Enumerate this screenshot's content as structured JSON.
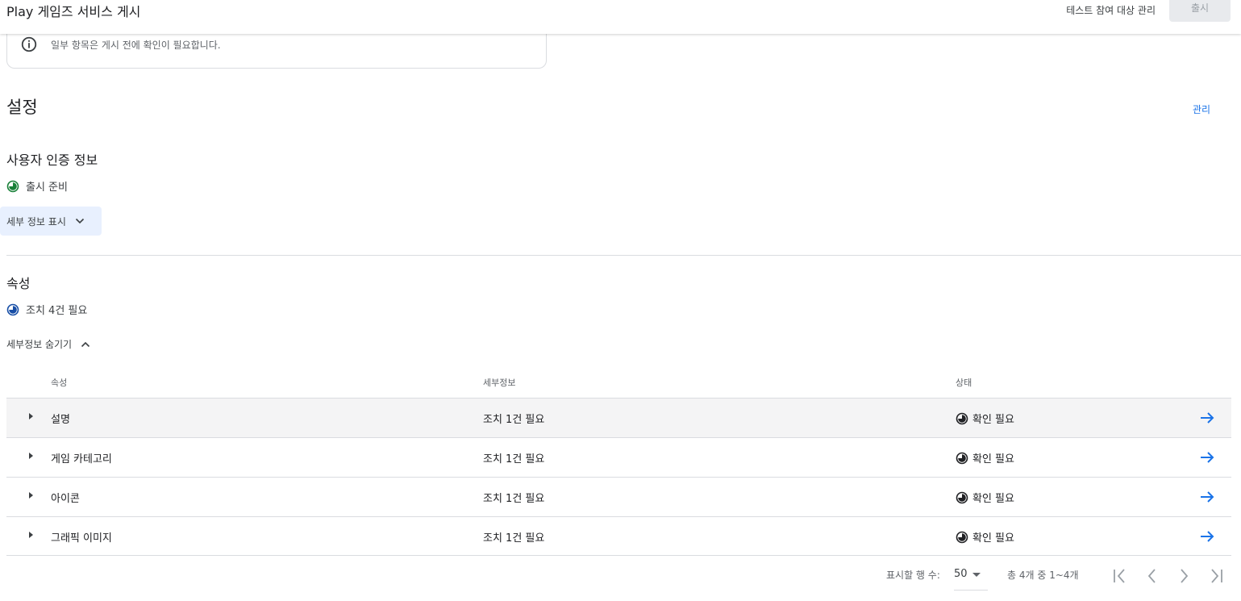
{
  "header": {
    "title": "Play 게임즈 서비스 게시",
    "manage_testers": "테스트 참여 대상 관리",
    "release_button": "출시"
  },
  "notice": {
    "text": "일부 항목은 게시 전에 확인이 필요합니다."
  },
  "settings": {
    "title": "설정",
    "manage_link": "관리",
    "credentials": {
      "title": "사용자 인증 정보",
      "status": "출시 준비",
      "toggle_label": "세부 정보 표시"
    },
    "properties": {
      "title": "속성",
      "status": "조치 4건 필요",
      "toggle_label": "세부정보 숨기기",
      "columns": [
        "속성",
        "세부정보",
        "상태"
      ],
      "rows": [
        {
          "name": "설명",
          "details": "조치 1건 필요",
          "status": "확인 필요"
        },
        {
          "name": "게임 카테고리",
          "details": "조치 1건 필요",
          "status": "확인 필요"
        },
        {
          "name": "아이콘",
          "details": "조치 1건 필요",
          "status": "확인 필요"
        },
        {
          "name": "그래픽 이미지",
          "details": "조치 1건 필요",
          "status": "확인 필요"
        }
      ]
    }
  },
  "pagination": {
    "rows_label": "표시할 행 수:",
    "rows_value": "50",
    "range": "총 4개 중 1~4개"
  },
  "colors": {
    "accent": "#1a73e8",
    "ready_green": "#188038",
    "pending_blue": "#174ea6",
    "chip_bg": "#e8f0fe"
  }
}
